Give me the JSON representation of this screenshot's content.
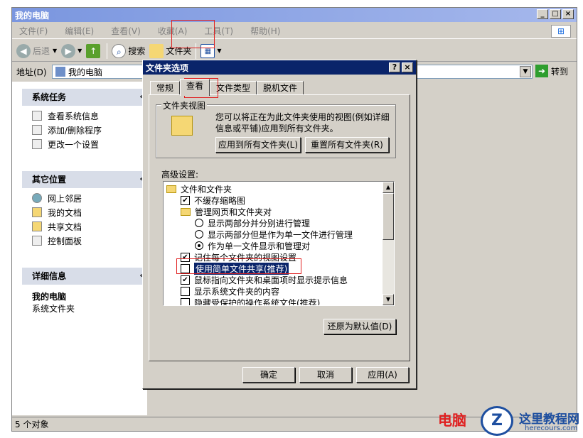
{
  "window": {
    "title": "我的电脑",
    "buttons": [
      "_",
      "□",
      "×"
    ],
    "menu": [
      "文件(F)",
      "编辑(E)",
      "查看(V)",
      "收藏(A)",
      "工具(T)",
      "帮助(H)"
    ],
    "toolbar": {
      "back_label": "后退",
      "search_label": "搜索",
      "folders_label": "文件夹"
    },
    "address": {
      "label": "地址(D)",
      "value": "我的电脑",
      "go_label": "转到"
    },
    "status": "5 个对象"
  },
  "left_pane": {
    "system_tasks": {
      "title": "系统任务",
      "items": [
        "查看系统信息",
        "添加/删除程序",
        "更改一个设置"
      ]
    },
    "other_places": {
      "title": "其它位置",
      "items": [
        "网上邻居",
        "我的文档",
        "共享文档",
        "控制面板"
      ]
    },
    "details": {
      "title": "详细信息",
      "name": "我的电脑",
      "desc": "系统文件夹"
    }
  },
  "dialog": {
    "title": "文件夹选项",
    "help_btn": "?",
    "close_btn": "×",
    "tabs": [
      "常规",
      "查看",
      "文件类型",
      "脱机文件"
    ],
    "active_tab": "查看",
    "folder_view": {
      "title": "文件夹视图",
      "text": "您可以将正在为此文件夹使用的视图(例如详细信息或平铺)应用到所有文件夹。",
      "apply_all": "应用到所有文件夹(L)",
      "reset_all": "重置所有文件夹(R)"
    },
    "advanced": {
      "label": "高级设置:",
      "rows": [
        {
          "type": "folder",
          "text": "文件和文件夹"
        },
        {
          "type": "check",
          "checked": true,
          "text": "不缓存缩略图"
        },
        {
          "type": "folder",
          "text": "管理网页和文件夹对"
        },
        {
          "type": "radio",
          "checked": false,
          "text": "显示两部分并分别进行管理"
        },
        {
          "type": "radio",
          "checked": false,
          "text": "显示两部分但是作为单一文件进行管理"
        },
        {
          "type": "radio",
          "checked": true,
          "text": "作为单一文件显示和管理对"
        },
        {
          "type": "check",
          "checked": true,
          "text": "记住每个文件夹的视图设置"
        },
        {
          "type": "check",
          "checked": false,
          "text": "使用简单文件共享(推荐)",
          "selected": true
        },
        {
          "type": "check",
          "checked": true,
          "text": "鼠标指向文件夹和桌面项时显示提示信息"
        },
        {
          "type": "check",
          "checked": false,
          "text": "显示系统文件夹的内容"
        },
        {
          "type": "check",
          "checked": false,
          "text": "隐藏受保护的操作系统文件(推荐)"
        }
      ]
    },
    "restore_default": "还原为默认值(D)",
    "ok": "确定",
    "cancel": "取消",
    "apply": "应用(A)"
  },
  "watermark": {
    "left_text": "电脑",
    "logo_letter": "Z",
    "site_name": "这里教程网",
    "site_url": "herecours.com"
  }
}
